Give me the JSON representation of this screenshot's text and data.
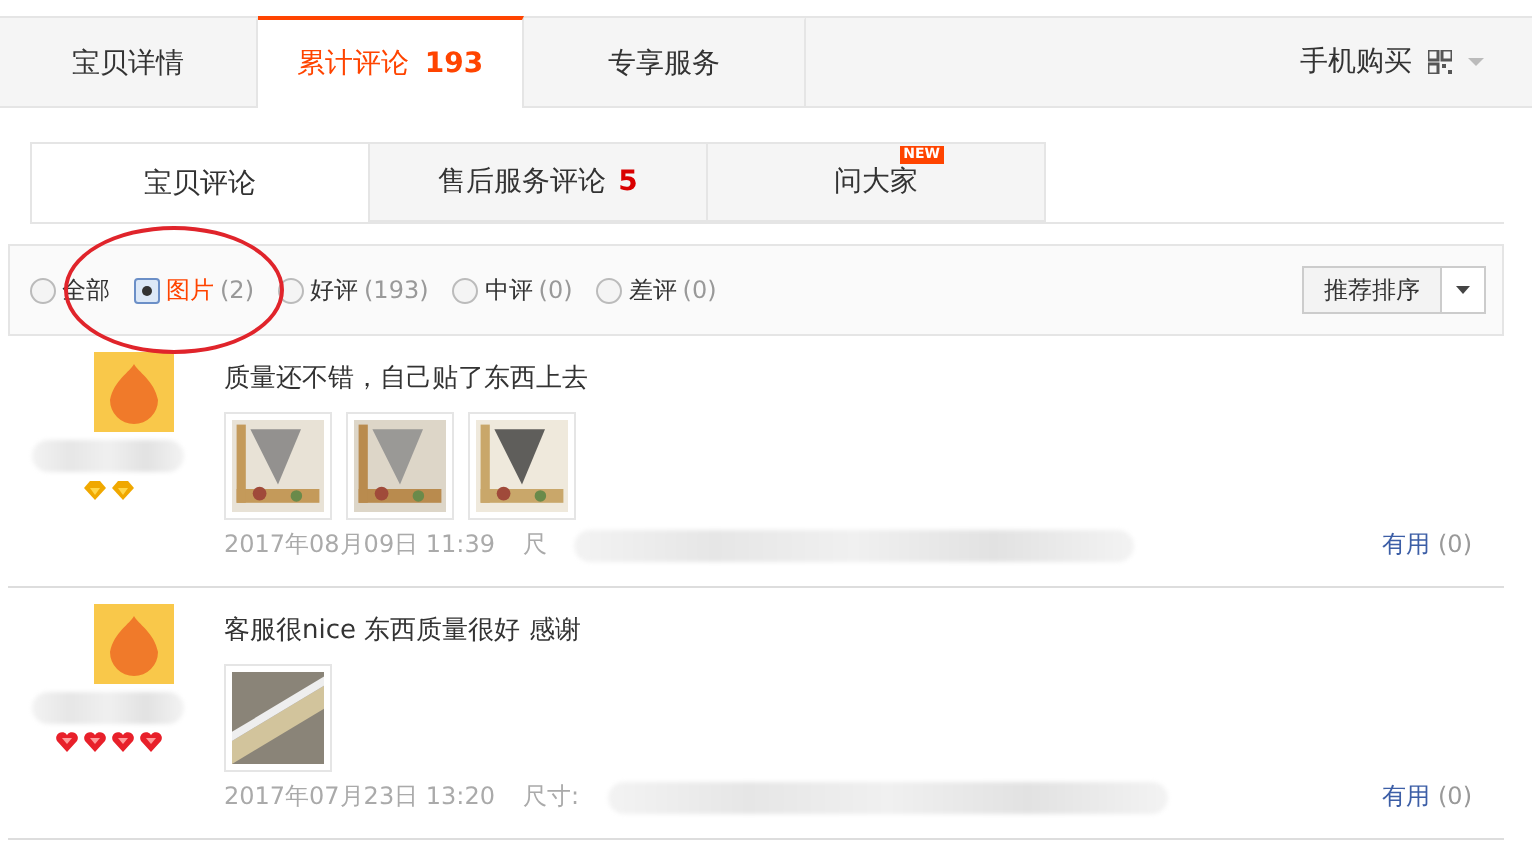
{
  "main_tabs": [
    {
      "label": "宝贝详情",
      "selected": false
    },
    {
      "label": "累计评论",
      "count": "193",
      "selected": true
    },
    {
      "label": "专享服务",
      "selected": false
    }
  ],
  "mobile_buy": {
    "label": "手机购买"
  },
  "sub_tabs": [
    {
      "label": "宝贝评论",
      "selected": true
    },
    {
      "label": "售后服务评论",
      "count": "5",
      "selected": false
    },
    {
      "label": "问大家",
      "badge": "NEW",
      "selected": false
    }
  ],
  "filters": [
    {
      "label": "全部",
      "selected": false
    },
    {
      "label": "图片",
      "count": "(2)",
      "selected": true
    },
    {
      "label": "好评",
      "count": "(193)",
      "selected": false
    },
    {
      "label": "中评",
      "count": "(0)",
      "selected": false
    },
    {
      "label": "差评",
      "count": "(0)",
      "selected": false
    }
  ],
  "sort": {
    "value": "推荐排序"
  },
  "reviews": [
    {
      "text": "质量还不错，自己贴了东西上去",
      "rank_icons": [
        {
          "kind": "diamond"
        },
        {
          "kind": "diamond"
        }
      ],
      "photos": [
        {
          "kind": "picture"
        },
        {
          "kind": "picture"
        },
        {
          "kind": "picture"
        }
      ],
      "date": "2017年08月09日 11:39",
      "spec": "尺",
      "useful": "有用",
      "useful_count": "(0)"
    },
    {
      "text": "客服很nice 东西质量很好 感谢",
      "rank_icons": [
        {
          "kind": "heart"
        },
        {
          "kind": "heart"
        },
        {
          "kind": "heart"
        },
        {
          "kind": "heart"
        }
      ],
      "photos": [
        {
          "kind": "picture"
        }
      ],
      "date": "2017年07月23日 13:20",
      "spec": "尺寸:",
      "useful": "有用",
      "useful_count": "(0)"
    }
  ]
}
